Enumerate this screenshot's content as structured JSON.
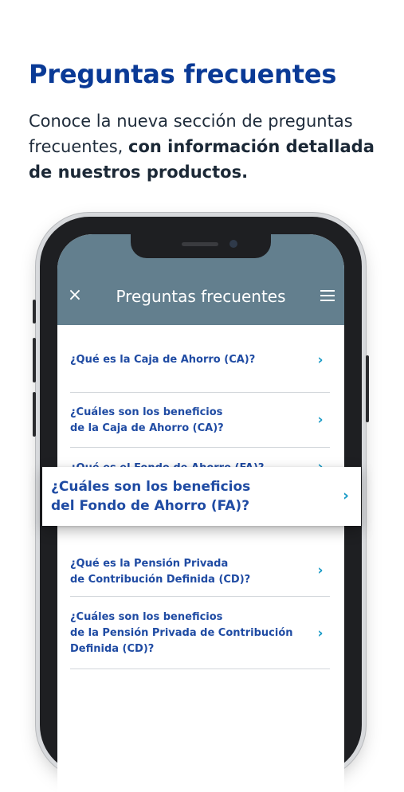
{
  "headline": "Preguntas frecuentes",
  "intro": {
    "regular": "Conoce la nueva sección de preguntas frecuentes,",
    "bold": "con información detallada de nuestros productos."
  },
  "app": {
    "title": "Preguntas frecuentes",
    "close_icon": "×",
    "menu_icon": "hamburger-menu"
  },
  "faq": [
    {
      "line1": "¿Qué es la Caja de Ahorro (CA)?",
      "line2": "",
      "line3": ""
    },
    {
      "line1": "¿Cuáles son los beneficios",
      "line2": "de la Caja de Ahorro (CA)?",
      "line3": ""
    },
    {
      "line1": "¿Qué es el Fondo de Ahorro (FA)?",
      "line2": "",
      "line3": ""
    },
    {
      "line1": "¿Qué es la Pensión Privada",
      "line2": "de Contribución Definida (CD)?",
      "line3": ""
    },
    {
      "line1": "¿Cuáles son los beneficios",
      "line2": "de la Pensión Privada de Contribución",
      "line3": "Definida (CD)?"
    }
  ],
  "featured": {
    "line1": "¿Cuáles son los beneficios",
    "line2": "del Fondo de Ahorro (FA)?"
  },
  "chevron": "›",
  "colors": {
    "headline": "#0a3a96",
    "header_bg": "#637f8e",
    "question_text": "#1f4ba3",
    "chevron": "#1a9bc7"
  }
}
